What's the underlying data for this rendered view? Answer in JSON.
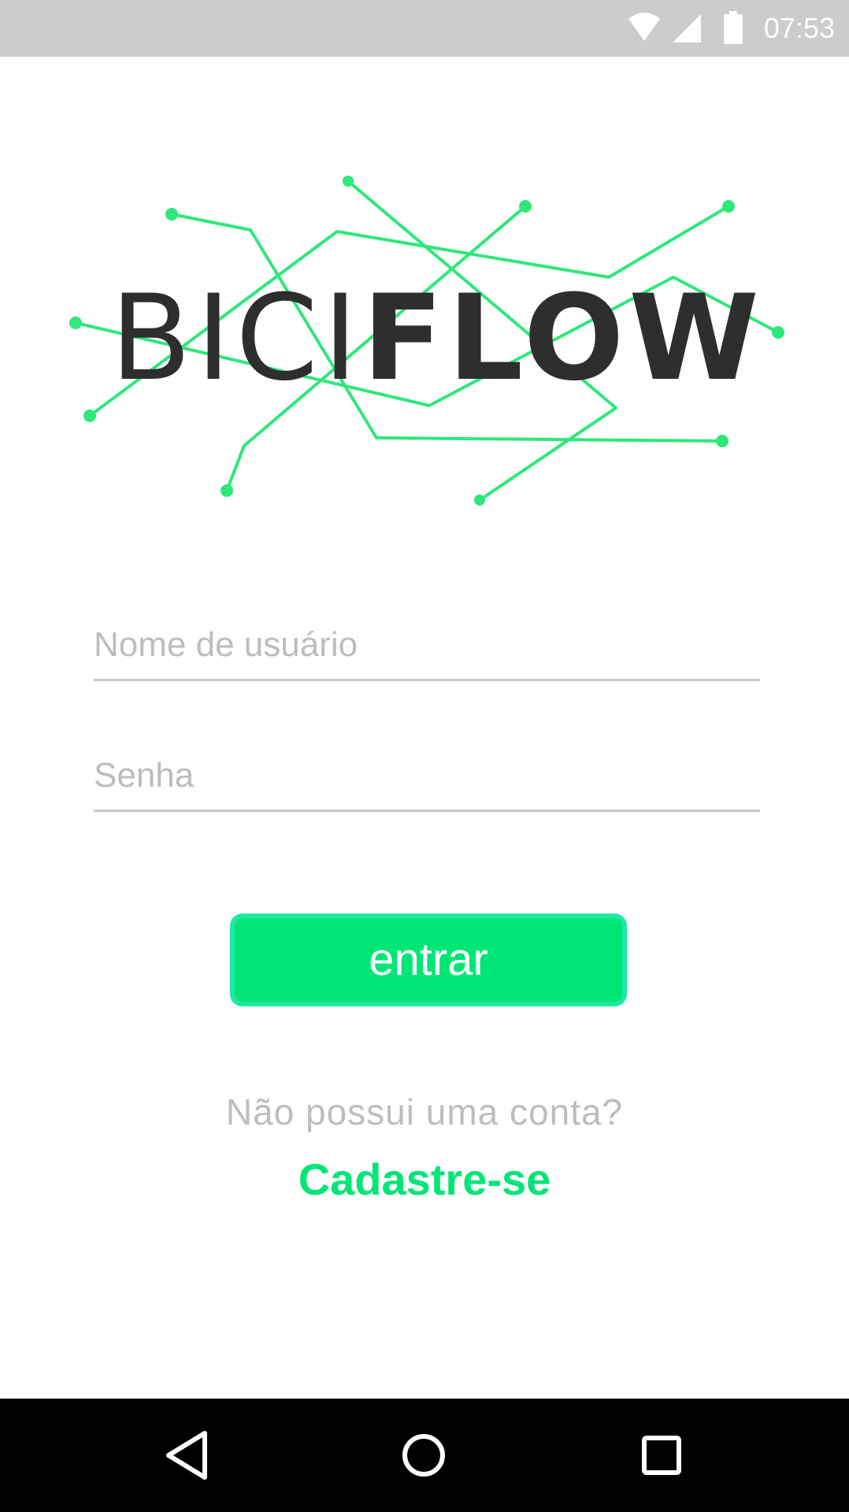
{
  "status_bar": {
    "time": "07:53",
    "icons": [
      "wifi-icon",
      "cell-signal-icon",
      "battery-icon"
    ]
  },
  "logo": {
    "text_light": "BICI",
    "text_bold": "FLOW",
    "line_color": "#2ee87a",
    "text_color": "#2e2e2e"
  },
  "login_form": {
    "username_placeholder": "Nome de usuário",
    "username_value": "",
    "password_placeholder": "Senha",
    "password_value": "",
    "submit_label": "entrar"
  },
  "signup": {
    "prompt": "Não possui uma conta?",
    "link_label": "Cadastre-se"
  },
  "nav_bar": {
    "buttons": [
      "back-icon",
      "home-icon",
      "recents-icon"
    ]
  },
  "colors": {
    "accent": "#00e676",
    "status_bar_bg": "#cccccc",
    "nav_bar_bg": "#000000"
  }
}
